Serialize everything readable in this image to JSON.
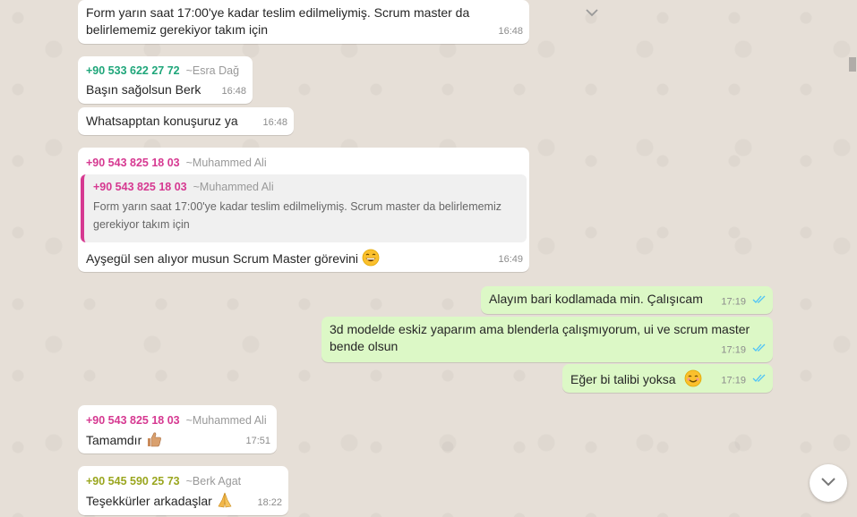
{
  "colors": {
    "incoming": "#ffffff",
    "outgoing": "#dcf8c6",
    "read_tick": "#4fc3f7",
    "sender_teal": "#1fa67a",
    "sender_pink": "#d63991",
    "sender_olive": "#9aa61f"
  },
  "messages": [
    {
      "text": "Form yarın saat 17:00'ye kadar teslim edilmeliymiş. Scrum master da\nbelirlememiz gerekiyor takım için",
      "time": "16:48"
    },
    {
      "phone": "+90 533 622 27 72",
      "alias": "~Esra Dağ",
      "text": "Başın sağolsun Berk",
      "time": "16:48"
    },
    {
      "text": "Whatsapptan konuşuruz ya",
      "time": "16:48"
    },
    {
      "phone": "+90 543 825 18 03",
      "alias": "~Muhammed Ali",
      "quote": {
        "phone": "+90 543 825 18 03",
        "alias": "~Muhammed Ali",
        "text": "Form yarın saat 17:00'ye kadar teslim edilmeliymiş. Scrum master da belirlememiz\ngerekiyor takım için"
      },
      "text": "Ayşegül sen alıyor musun Scrum Master görevini",
      "emoji": "grinning-face",
      "time": "16:49"
    },
    {
      "text": "Alayım bari kodlamada min. Çalışıcam",
      "time": "17:19"
    },
    {
      "text": "3d modelde eskiz yaparım ama blenderla çalışmıyorum, ui ve scrum master\nbende olsun",
      "time": "17:19"
    },
    {
      "text": "Eğer bi talibi yoksa",
      "emoji": "smiling-face",
      "time": "17:19"
    },
    {
      "phone": "+90 543 825 18 03",
      "alias": "~Muhammed Ali",
      "text": "Tamamdır",
      "emoji": "thumbs-up",
      "time": "17:51"
    },
    {
      "phone": "+90 545 590 25 73",
      "alias": "~Berk Agat",
      "text": "Teşekkürler arkadaşlar",
      "emoji": "folded-hands",
      "time": "18:22"
    }
  ]
}
